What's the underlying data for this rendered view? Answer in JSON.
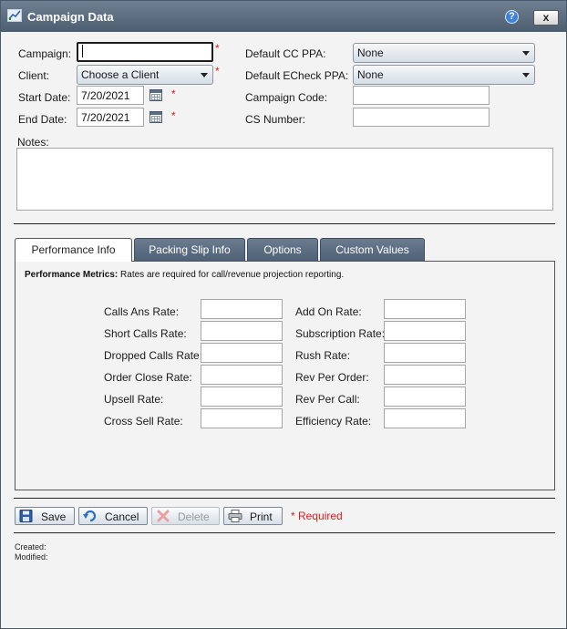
{
  "window": {
    "title": "Campaign Data",
    "help_label": "?",
    "close_label": "x"
  },
  "form": {
    "campaign_label": "Campaign:",
    "campaign_value": "",
    "client_label": "Client:",
    "client_value": "Choose a Client",
    "start_date_label": "Start Date:",
    "start_date_value": "7/20/2021",
    "end_date_label": "End Date:",
    "end_date_value": "7/20/2021",
    "default_cc_label": "Default CC PPA:",
    "default_cc_value": "None",
    "default_echeck_label": "Default ECheck PPA:",
    "default_echeck_value": "None",
    "campaign_code_label": "Campaign Code:",
    "campaign_code_value": "",
    "cs_number_label": "CS Number:",
    "cs_number_value": "",
    "notes_label": "Notes:",
    "notes_value": "",
    "required_marker": "*"
  },
  "tabs": [
    {
      "label": "Performance Info",
      "active": true
    },
    {
      "label": "Packing Slip Info",
      "active": false
    },
    {
      "label": "Options",
      "active": false
    },
    {
      "label": "Custom Values",
      "active": false
    }
  ],
  "performance": {
    "heading_bold": "Performance Metrics:",
    "heading_text": "Rates are required for call/revenue projection reporting.",
    "left_metrics": [
      {
        "label": "Calls Ans Rate:",
        "value": ""
      },
      {
        "label": "Short Calls Rate:",
        "value": ""
      },
      {
        "label": "Dropped Calls Rate:",
        "value": ""
      },
      {
        "label": "Order Close Rate:",
        "value": ""
      },
      {
        "label": "Upsell Rate:",
        "value": ""
      },
      {
        "label": "Cross Sell Rate:",
        "value": ""
      }
    ],
    "right_metrics": [
      {
        "label": "Add On Rate:",
        "value": ""
      },
      {
        "label": "Subscription Rate:",
        "value": ""
      },
      {
        "label": "Rush Rate:",
        "value": ""
      },
      {
        "label": "Rev Per Order:",
        "value": ""
      },
      {
        "label": "Rev Per Call:",
        "value": ""
      },
      {
        "label": "Efficiency Rate:",
        "value": ""
      }
    ]
  },
  "actions": {
    "save_label": "Save",
    "cancel_label": "Cancel",
    "delete_label": "Delete",
    "print_label": "Print",
    "required_note": "* Required"
  },
  "footer": {
    "created_label": "Created:",
    "modified_label": "Modified:"
  },
  "colors": {
    "titlebar": "#56687b",
    "required": "#d42020",
    "tab_inactive": "#5d6f84"
  }
}
